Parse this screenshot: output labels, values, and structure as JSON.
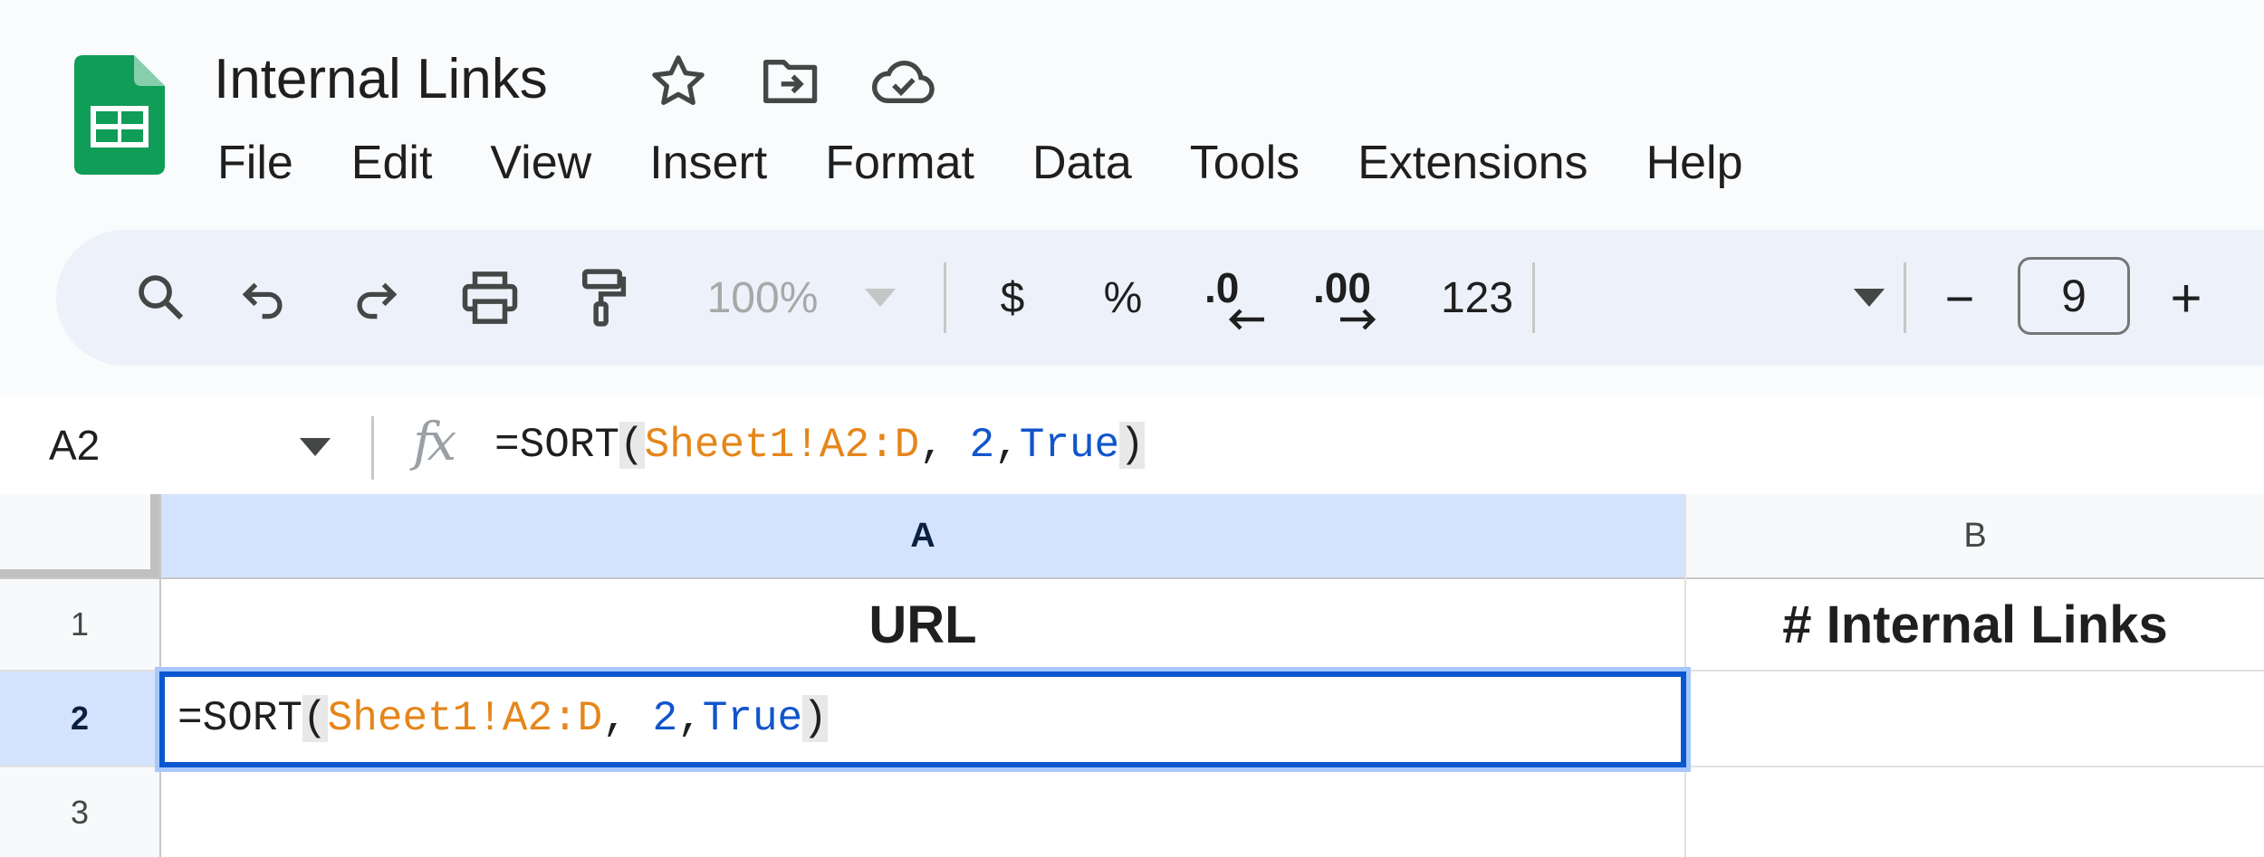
{
  "document": {
    "title": "Internal Links"
  },
  "menu": [
    "File",
    "Edit",
    "View",
    "Insert",
    "Format",
    "Data",
    "Tools",
    "Extensions",
    "Help"
  ],
  "toolbar": {
    "zoom": "100%",
    "currency_label": "$",
    "percent_label": "%",
    "decrease_decimal_label": ".0",
    "increase_decimal_label": ".00",
    "number_format_label": "123",
    "font_size": "9",
    "minus_label": "−",
    "plus_label": "+"
  },
  "formula_bar": {
    "name_box": "A2",
    "fx_label": "fx",
    "formula": {
      "eq": "=SORT",
      "open": "(",
      "range": "Sheet1!A2:D",
      "sep1": ", ",
      "num": "2",
      "sep2": ",",
      "bool": "True",
      "close": ")"
    }
  },
  "grid": {
    "columns": [
      "A",
      "B"
    ],
    "rows": [
      "1",
      "2",
      "3"
    ],
    "cells": {
      "A1": "URL",
      "B1": "# Internal Links"
    },
    "active_cell": "A2"
  },
  "colors": {
    "sheets_green": "#0f9d58",
    "selection_blue": "#0b57d0",
    "header_selected": "#d3e3fd",
    "range_orange": "#e5861a",
    "number_blue": "#1155cc"
  }
}
